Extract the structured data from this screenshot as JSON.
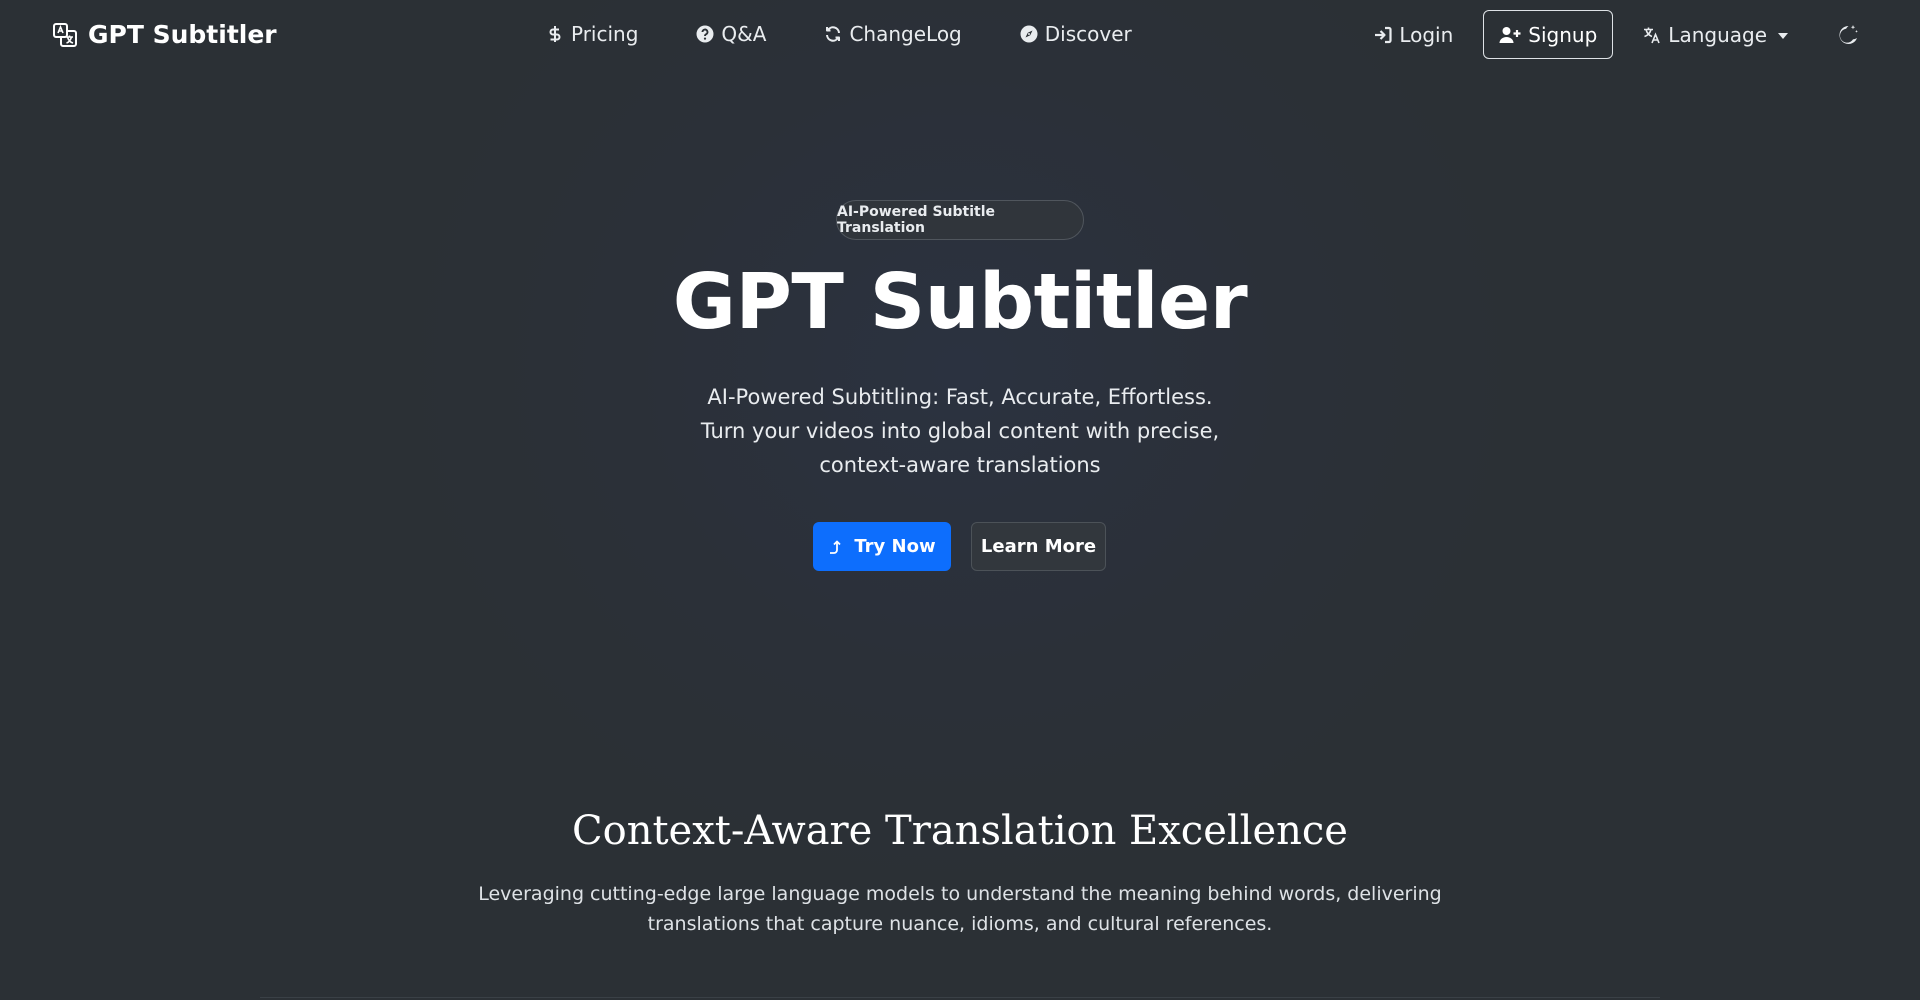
{
  "navbar": {
    "brand": "GPT Subtitler",
    "links": {
      "pricing": "Pricing",
      "qa": "Q&A",
      "changelog": "ChangeLog",
      "discover": "Discover"
    },
    "login": "Login",
    "signup": "Signup",
    "language": "Language"
  },
  "hero": {
    "badge": "AI-Powered Subtitle Translation",
    "title": "GPT Subtitler",
    "subtitle_line1": "AI-Powered Subtitling: Fast, Accurate, Effortless.",
    "subtitle_line2": "Turn your videos into global content with precise,",
    "subtitle_line3": "context-aware translations",
    "try_now": "Try Now",
    "learn_more": "Learn More"
  },
  "features": {
    "title": "Context-Aware Translation Excellence",
    "desc_line1": "Leveraging cutting-edge large language models to understand the meaning behind words, delivering",
    "desc_line2": "translations that capture nuance, idioms, and cultural references."
  },
  "colors": {
    "background": "#2b3035",
    "primary": "#0d6efd",
    "text": "#f8f9fa"
  },
  "icons": {
    "brand": "translate-icon",
    "pricing": "dollar-icon",
    "qa": "question-circle-icon",
    "changelog": "refresh-icon",
    "discover": "compass-icon",
    "login": "sign-in-icon",
    "signup": "user-plus-icon",
    "language": "language-icon",
    "theme": "moon-stars-icon",
    "try_now": "upload-arrow-icon"
  }
}
